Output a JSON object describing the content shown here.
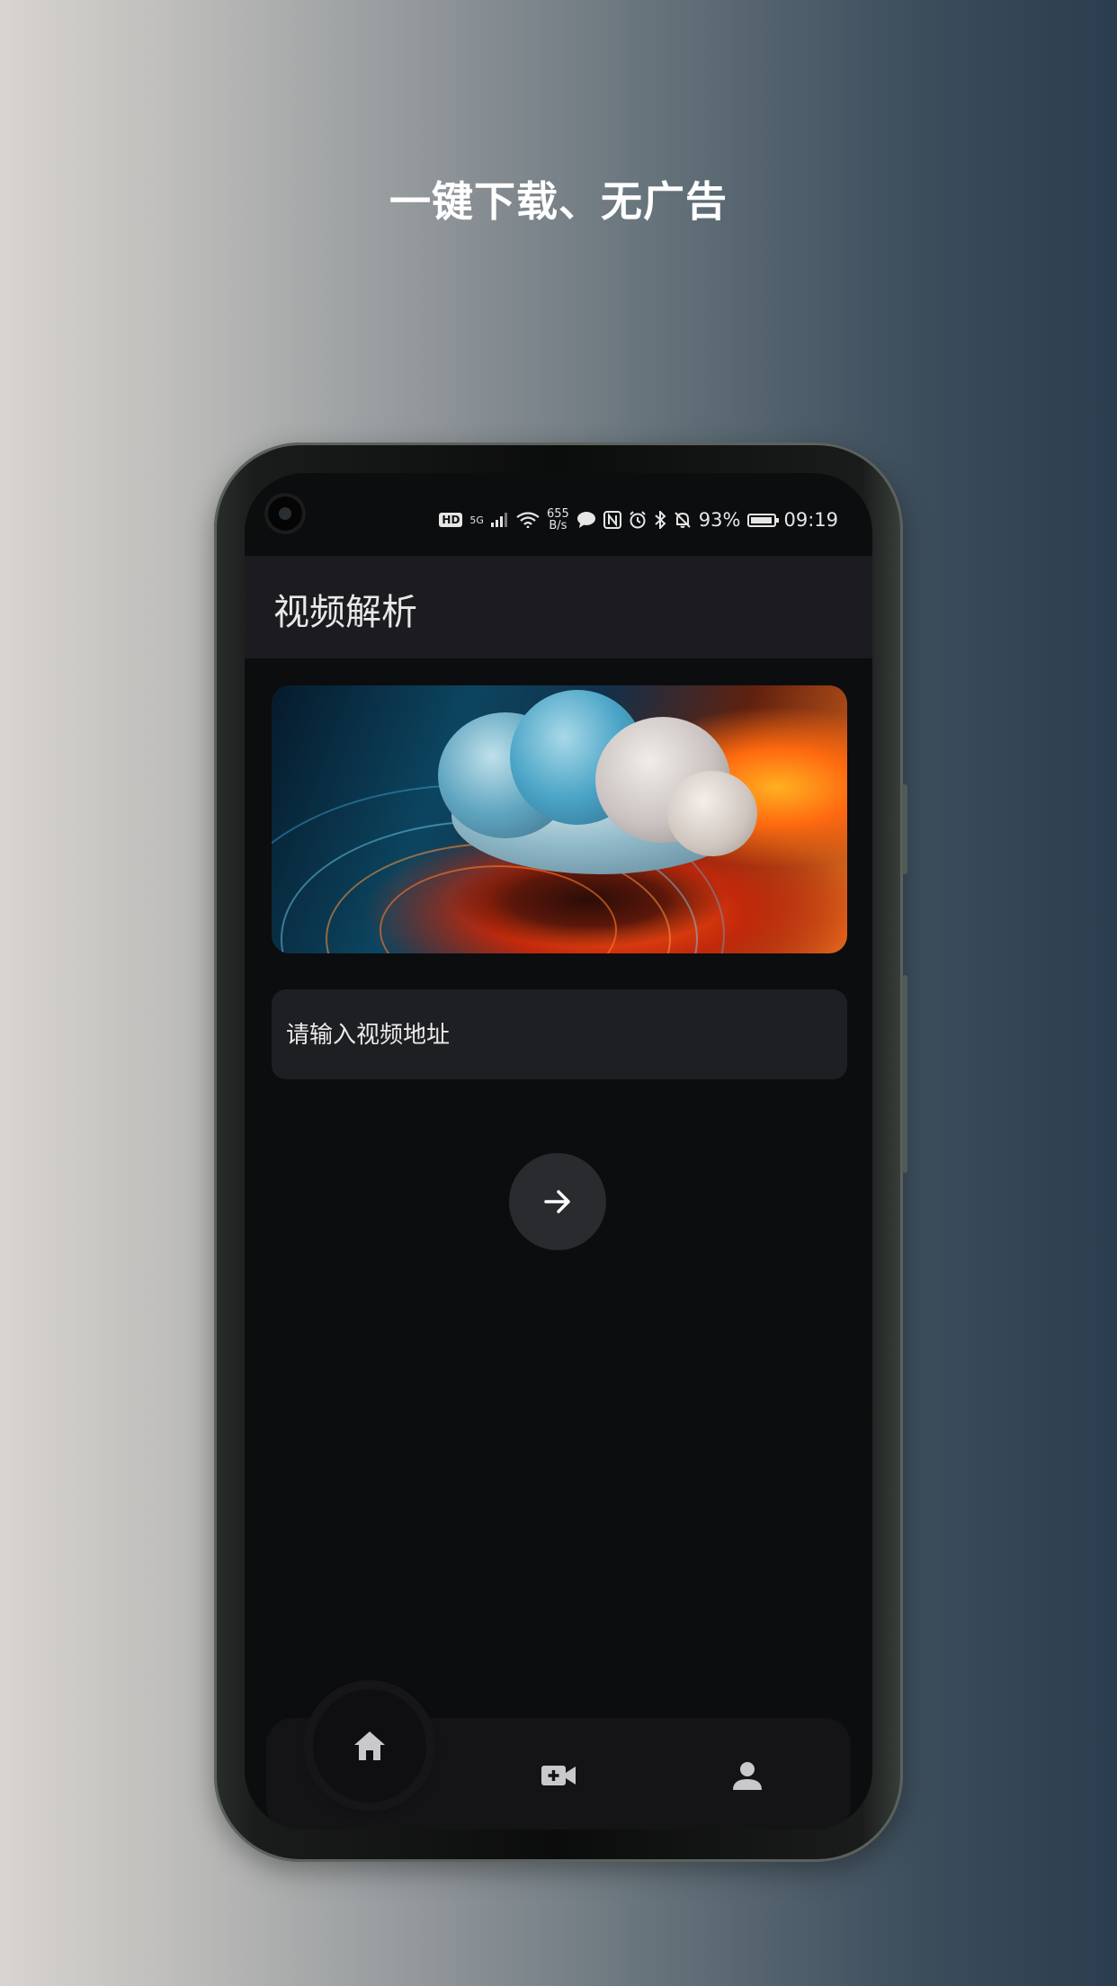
{
  "promo": {
    "headline": "一键下载、无广告"
  },
  "status_bar": {
    "hd": "HD",
    "network": "5G",
    "speed_value": "655",
    "speed_unit": "B/s",
    "nfc": "N",
    "battery_percent": "93%",
    "time": "09:19",
    "icons": [
      "signal-icon",
      "wifi-icon",
      "message-icon",
      "nfc-icon",
      "alarm-icon",
      "bluetooth-icon",
      "mute-icon",
      "battery-icon"
    ]
  },
  "app": {
    "title": "视频解析",
    "input": {
      "placeholder": "请输入视频地址",
      "value": ""
    },
    "submit": {
      "icon": "arrow-right-icon"
    }
  },
  "bottom_nav": {
    "items": [
      {
        "icon": "home-icon",
        "active": true
      },
      {
        "icon": "video-add-icon",
        "active": false
      },
      {
        "icon": "person-icon",
        "active": false
      }
    ]
  },
  "colors": {
    "screen_bg": "#0c0d0f",
    "appbar_bg": "#1c1c20",
    "input_bg": "#1e1f22",
    "fab_bg": "#2a2b2e",
    "text": "#e8e8ea"
  }
}
